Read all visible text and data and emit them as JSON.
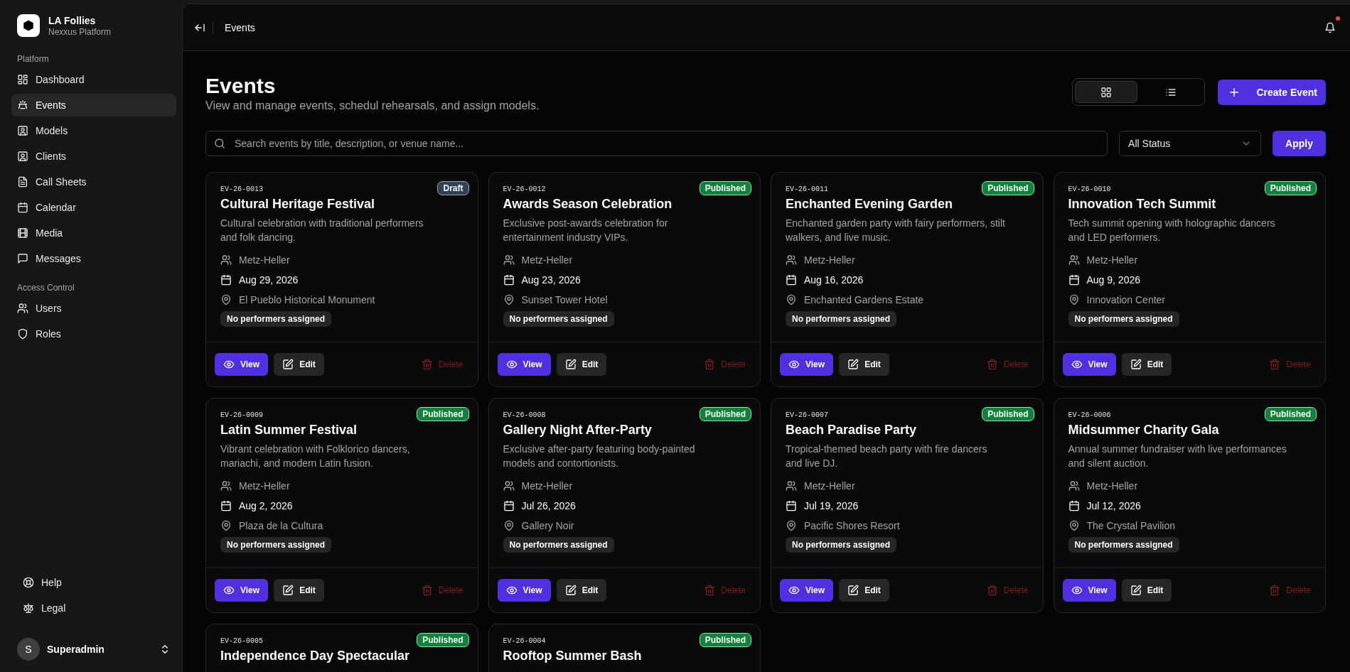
{
  "sidebar": {
    "brand": {
      "name": "LA Follies",
      "subtitle": "Nexxus Platform"
    },
    "sections": [
      {
        "title": "Platform",
        "items": [
          {
            "label": "Dashboard",
            "selected": false
          },
          {
            "label": "Events",
            "selected": true
          },
          {
            "label": "Models",
            "selected": false
          },
          {
            "label": "Clients",
            "selected": false
          },
          {
            "label": "Call Sheets",
            "selected": false
          },
          {
            "label": "Calendar",
            "selected": false
          },
          {
            "label": "Media",
            "selected": false
          },
          {
            "label": "Messages",
            "selected": false
          }
        ]
      },
      {
        "title": "Access Control",
        "items": [
          {
            "label": "Users",
            "selected": false
          },
          {
            "label": "Roles",
            "selected": false
          }
        ]
      }
    ],
    "footer_links": [
      {
        "label": "Help"
      },
      {
        "label": "Legal"
      }
    ],
    "user": {
      "initial": "S",
      "name": "Superadmin"
    }
  },
  "header": {
    "breadcrumb": "Events",
    "notification_unread": true
  },
  "page": {
    "title": "Events",
    "subtitle": "View and manage events, schedul rehearsals, and assign models.",
    "view_toggle": [
      {
        "selected": true
      },
      {
        "selected": false
      }
    ],
    "create_button": "Create Event",
    "search": {
      "placeholder": "Search events by title, description, or venue name..."
    },
    "status_filter": "All Status",
    "apply_button": "Apply"
  },
  "events": [
    {
      "id": "EV-26-0013",
      "status": "Draft",
      "kind": "draft",
      "title": "Cultural Heritage Festival",
      "description": "Cultural celebration with traditional performers and folk dancing.",
      "client": "Metz-Heller",
      "date": "Aug 29, 2026",
      "venue": "El Pueblo Historical Monument",
      "performers": "No performers assigned",
      "actions": [
        "View",
        "Edit",
        "Delete"
      ]
    },
    {
      "id": "EV-26-0012",
      "status": "Published",
      "kind": "published",
      "title": "Awards Season Celebration",
      "description": "Exclusive post-awards celebration for entertainment industry VIPs.",
      "client": "Metz-Heller",
      "date": "Aug 23, 2026",
      "venue": "Sunset Tower Hotel",
      "performers": "No performers assigned",
      "actions": [
        "View",
        "Edit",
        "Delete"
      ]
    },
    {
      "id": "EV-26-0011",
      "status": "Published",
      "kind": "published",
      "title": "Enchanted Evening Garden",
      "description": "Enchanted garden party with fairy performers, stilt walkers, and live music.",
      "client": "Metz-Heller",
      "date": "Aug 16, 2026",
      "venue": "Enchanted Gardens Estate",
      "performers": "No performers assigned",
      "actions": [
        "View",
        "Edit",
        "Delete"
      ]
    },
    {
      "id": "EV-26-0010",
      "status": "Published",
      "kind": "published",
      "title": "Innovation Tech Summit",
      "description": "Tech summit opening with holographic dancers and LED performers.",
      "client": "Metz-Heller",
      "date": "Aug 9, 2026",
      "venue": "Innovation Center",
      "performers": "No performers assigned",
      "actions": [
        "View",
        "Edit",
        "Delete"
      ]
    },
    {
      "id": "EV-26-0009",
      "status": "Published",
      "kind": "published",
      "title": "Latin Summer Festival",
      "description": "Vibrant celebration with Folklorico dancers, mariachi, and modern Latin fusion.",
      "client": "Metz-Heller",
      "date": "Aug 2, 2026",
      "venue": "Plaza de la Cultura",
      "performers": "No performers assigned",
      "actions": [
        "View",
        "Edit",
        "Delete"
      ]
    },
    {
      "id": "EV-26-0008",
      "status": "Published",
      "kind": "published",
      "title": "Gallery Night After-Party",
      "description": "Exclusive after-party featuring body-painted models and contortionists.",
      "client": "Metz-Heller",
      "date": "Jul 26, 2026",
      "venue": "Gallery Noir",
      "performers": "No performers assigned",
      "actions": [
        "View",
        "Edit",
        "Delete"
      ]
    },
    {
      "id": "EV-26-0007",
      "status": "Published",
      "kind": "published",
      "title": "Beach Paradise Party",
      "description": "Tropical-themed beach party with fire dancers and live DJ.",
      "client": "Metz-Heller",
      "date": "Jul 19, 2026",
      "venue": "Pacific Shores Resort",
      "performers": "No performers assigned",
      "actions": [
        "View",
        "Edit",
        "Delete"
      ]
    },
    {
      "id": "EV-26-0006",
      "status": "Published",
      "kind": "published",
      "title": "Midsummer Charity Gala",
      "description": "Annual summer fundraiser with live performances and silent auction.",
      "client": "Metz-Heller",
      "date": "Jul 12, 2026",
      "venue": "The Crystal Pavilion",
      "performers": "No performers assigned",
      "actions": [
        "View",
        "Edit",
        "Delete"
      ]
    },
    {
      "id": "EV-26-0005",
      "status": "Published",
      "kind": "published",
      "title": "Independence Day Spectacular"
    },
    {
      "id": "EV-26-0004",
      "status": "Published",
      "kind": "published",
      "title": "Rooftop Summer Bash"
    }
  ]
}
